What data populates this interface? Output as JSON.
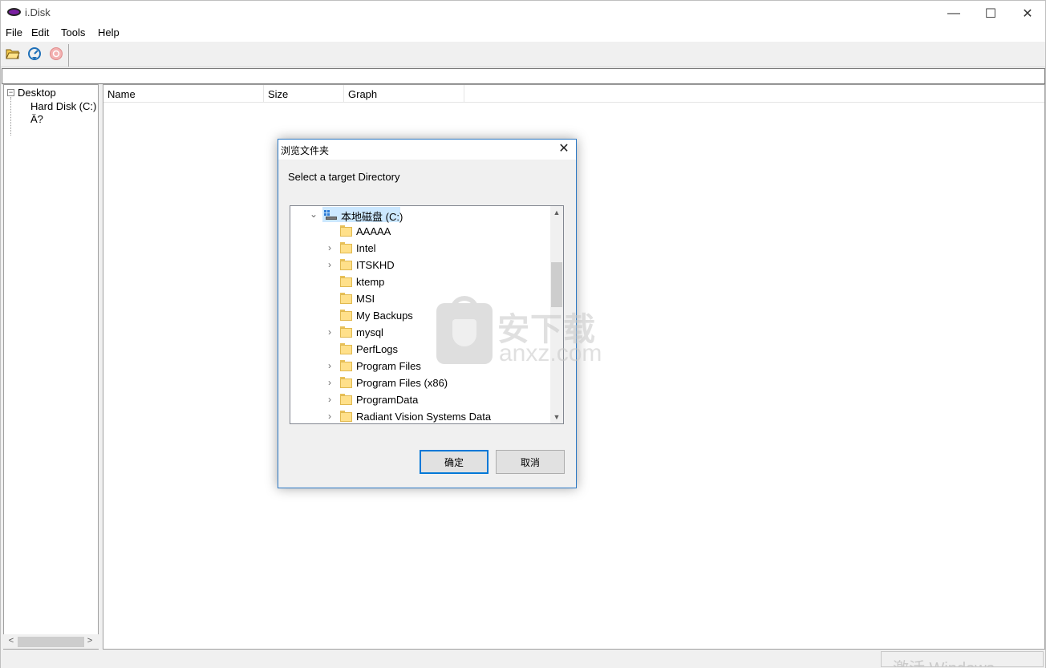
{
  "window": {
    "title": "i.Disk",
    "controls": {
      "minimize": "—",
      "maximize": "☐",
      "close": "✕"
    }
  },
  "menu": [
    {
      "label": "File"
    },
    {
      "label": "Edit"
    },
    {
      "label": "Tools"
    },
    {
      "label": "Help"
    }
  ],
  "toolbar": {
    "buttons": [
      {
        "icon": "open-folder-icon"
      },
      {
        "icon": "refresh-icon"
      },
      {
        "icon": "stop-icon",
        "disabled": true
      }
    ]
  },
  "address": {
    "value": ""
  },
  "tree": {
    "root": "Desktop",
    "expander": "−",
    "child": "Hard Disk (C:) Ä?"
  },
  "list": {
    "columns": [
      "Name",
      "Size",
      "Graph"
    ]
  },
  "status": {
    "text": "激活 Windows"
  },
  "dialog": {
    "title": "浏览文件夹",
    "close": "✕",
    "prompt": "Select a target Directory",
    "root_label": "本地磁盘 (C:)",
    "folders": [
      {
        "label": "AAAAA",
        "expandable": false
      },
      {
        "label": "Intel",
        "expandable": true
      },
      {
        "label": "ITSKHD",
        "expandable": true
      },
      {
        "label": "ktemp",
        "expandable": false
      },
      {
        "label": "MSI",
        "expandable": false
      },
      {
        "label": "My Backups",
        "expandable": false
      },
      {
        "label": "mysql",
        "expandable": true
      },
      {
        "label": "PerfLogs",
        "expandable": false
      },
      {
        "label": "Program Files",
        "expandable": true
      },
      {
        "label": "Program Files (x86)",
        "expandable": true
      },
      {
        "label": "ProgramData",
        "expandable": true
      },
      {
        "label": "Radiant Vision Systems Data",
        "expandable": true
      }
    ],
    "ok_label": "确定",
    "cancel_label": "取消"
  },
  "watermark": {
    "cn": "安下载",
    "en": "anxz.com"
  }
}
